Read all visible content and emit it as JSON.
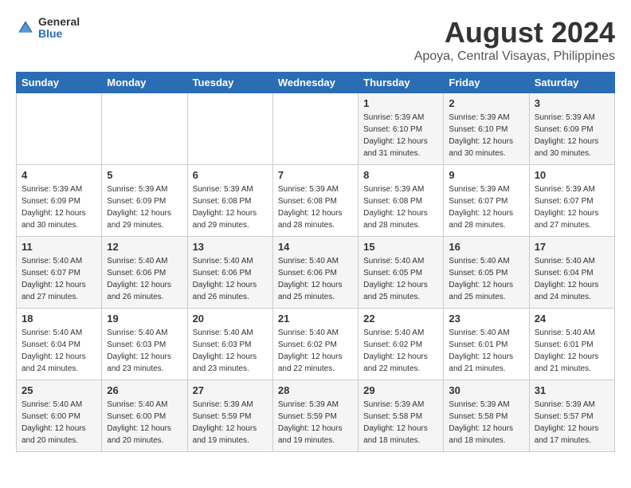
{
  "logo": {
    "general": "General",
    "blue": "Blue"
  },
  "title": "August 2024",
  "subtitle": "Apoya, Central Visayas, Philippines",
  "headers": [
    "Sunday",
    "Monday",
    "Tuesday",
    "Wednesday",
    "Thursday",
    "Friday",
    "Saturday"
  ],
  "weeks": [
    [
      {
        "day": "",
        "info": ""
      },
      {
        "day": "",
        "info": ""
      },
      {
        "day": "",
        "info": ""
      },
      {
        "day": "",
        "info": ""
      },
      {
        "day": "1",
        "info": "Sunrise: 5:39 AM\nSunset: 6:10 PM\nDaylight: 12 hours\nand 31 minutes."
      },
      {
        "day": "2",
        "info": "Sunrise: 5:39 AM\nSunset: 6:10 PM\nDaylight: 12 hours\nand 30 minutes."
      },
      {
        "day": "3",
        "info": "Sunrise: 5:39 AM\nSunset: 6:09 PM\nDaylight: 12 hours\nand 30 minutes."
      }
    ],
    [
      {
        "day": "4",
        "info": "Sunrise: 5:39 AM\nSunset: 6:09 PM\nDaylight: 12 hours\nand 30 minutes."
      },
      {
        "day": "5",
        "info": "Sunrise: 5:39 AM\nSunset: 6:09 PM\nDaylight: 12 hours\nand 29 minutes."
      },
      {
        "day": "6",
        "info": "Sunrise: 5:39 AM\nSunset: 6:08 PM\nDaylight: 12 hours\nand 29 minutes."
      },
      {
        "day": "7",
        "info": "Sunrise: 5:39 AM\nSunset: 6:08 PM\nDaylight: 12 hours\nand 28 minutes."
      },
      {
        "day": "8",
        "info": "Sunrise: 5:39 AM\nSunset: 6:08 PM\nDaylight: 12 hours\nand 28 minutes."
      },
      {
        "day": "9",
        "info": "Sunrise: 5:39 AM\nSunset: 6:07 PM\nDaylight: 12 hours\nand 28 minutes."
      },
      {
        "day": "10",
        "info": "Sunrise: 5:39 AM\nSunset: 6:07 PM\nDaylight: 12 hours\nand 27 minutes."
      }
    ],
    [
      {
        "day": "11",
        "info": "Sunrise: 5:40 AM\nSunset: 6:07 PM\nDaylight: 12 hours\nand 27 minutes."
      },
      {
        "day": "12",
        "info": "Sunrise: 5:40 AM\nSunset: 6:06 PM\nDaylight: 12 hours\nand 26 minutes."
      },
      {
        "day": "13",
        "info": "Sunrise: 5:40 AM\nSunset: 6:06 PM\nDaylight: 12 hours\nand 26 minutes."
      },
      {
        "day": "14",
        "info": "Sunrise: 5:40 AM\nSunset: 6:06 PM\nDaylight: 12 hours\nand 25 minutes."
      },
      {
        "day": "15",
        "info": "Sunrise: 5:40 AM\nSunset: 6:05 PM\nDaylight: 12 hours\nand 25 minutes."
      },
      {
        "day": "16",
        "info": "Sunrise: 5:40 AM\nSunset: 6:05 PM\nDaylight: 12 hours\nand 25 minutes."
      },
      {
        "day": "17",
        "info": "Sunrise: 5:40 AM\nSunset: 6:04 PM\nDaylight: 12 hours\nand 24 minutes."
      }
    ],
    [
      {
        "day": "18",
        "info": "Sunrise: 5:40 AM\nSunset: 6:04 PM\nDaylight: 12 hours\nand 24 minutes."
      },
      {
        "day": "19",
        "info": "Sunrise: 5:40 AM\nSunset: 6:03 PM\nDaylight: 12 hours\nand 23 minutes."
      },
      {
        "day": "20",
        "info": "Sunrise: 5:40 AM\nSunset: 6:03 PM\nDaylight: 12 hours\nand 23 minutes."
      },
      {
        "day": "21",
        "info": "Sunrise: 5:40 AM\nSunset: 6:02 PM\nDaylight: 12 hours\nand 22 minutes."
      },
      {
        "day": "22",
        "info": "Sunrise: 5:40 AM\nSunset: 6:02 PM\nDaylight: 12 hours\nand 22 minutes."
      },
      {
        "day": "23",
        "info": "Sunrise: 5:40 AM\nSunset: 6:01 PM\nDaylight: 12 hours\nand 21 minutes."
      },
      {
        "day": "24",
        "info": "Sunrise: 5:40 AM\nSunset: 6:01 PM\nDaylight: 12 hours\nand 21 minutes."
      }
    ],
    [
      {
        "day": "25",
        "info": "Sunrise: 5:40 AM\nSunset: 6:00 PM\nDaylight: 12 hours\nand 20 minutes."
      },
      {
        "day": "26",
        "info": "Sunrise: 5:40 AM\nSunset: 6:00 PM\nDaylight: 12 hours\nand 20 minutes."
      },
      {
        "day": "27",
        "info": "Sunrise: 5:39 AM\nSunset: 5:59 PM\nDaylight: 12 hours\nand 19 minutes."
      },
      {
        "day": "28",
        "info": "Sunrise: 5:39 AM\nSunset: 5:59 PM\nDaylight: 12 hours\nand 19 minutes."
      },
      {
        "day": "29",
        "info": "Sunrise: 5:39 AM\nSunset: 5:58 PM\nDaylight: 12 hours\nand 18 minutes."
      },
      {
        "day": "30",
        "info": "Sunrise: 5:39 AM\nSunset: 5:58 PM\nDaylight: 12 hours\nand 18 minutes."
      },
      {
        "day": "31",
        "info": "Sunrise: 5:39 AM\nSunset: 5:57 PM\nDaylight: 12 hours\nand 17 minutes."
      }
    ]
  ]
}
